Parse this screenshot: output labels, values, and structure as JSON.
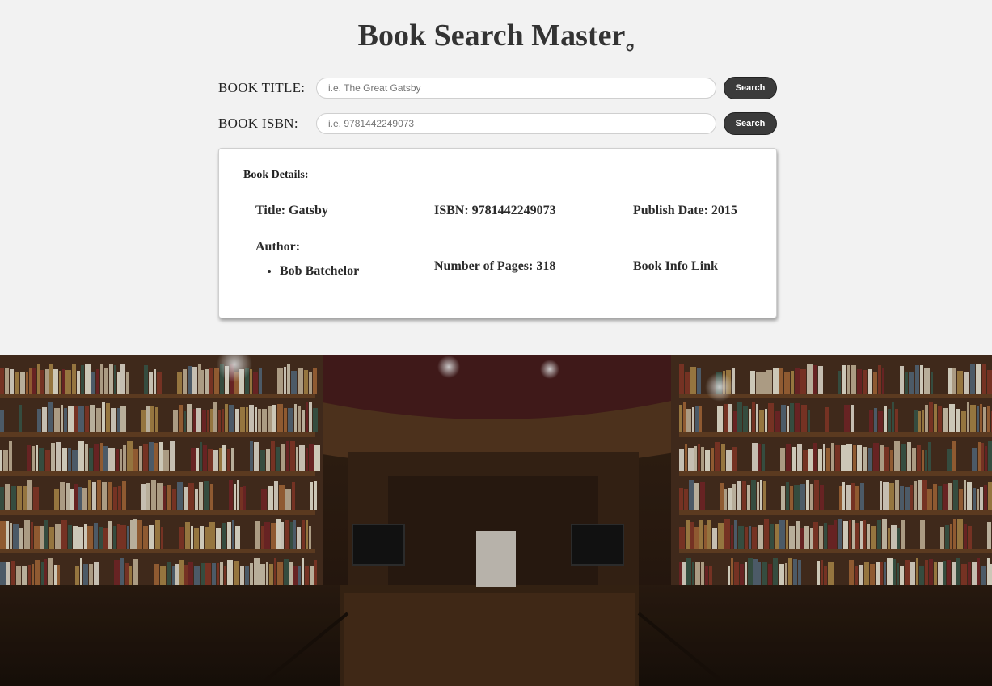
{
  "header": {
    "title": "Book Search Master"
  },
  "search": {
    "title_label": "BOOK TITLE:",
    "title_placeholder": "i.e. The Great Gatsby",
    "title_button": "Search",
    "isbn_label": "BOOK ISBN:",
    "isbn_placeholder": "i.e. 9781442249073",
    "isbn_button": "Search"
  },
  "details": {
    "heading": "Book Details:",
    "title": "Title: Gatsby",
    "isbn": "ISBN: 9781442249073",
    "publish_date": "Publish Date: 2015",
    "author_label": "Author:",
    "authors": [
      "Bob Batchelor"
    ],
    "pages": "Number of Pages: 318",
    "link_text": "Book Info Link"
  },
  "colors": {
    "background": "#f2f2f2",
    "button": "#3b3b3b",
    "card": "#ffffff"
  },
  "icons": {
    "title_mark": "book-logo-icon"
  }
}
